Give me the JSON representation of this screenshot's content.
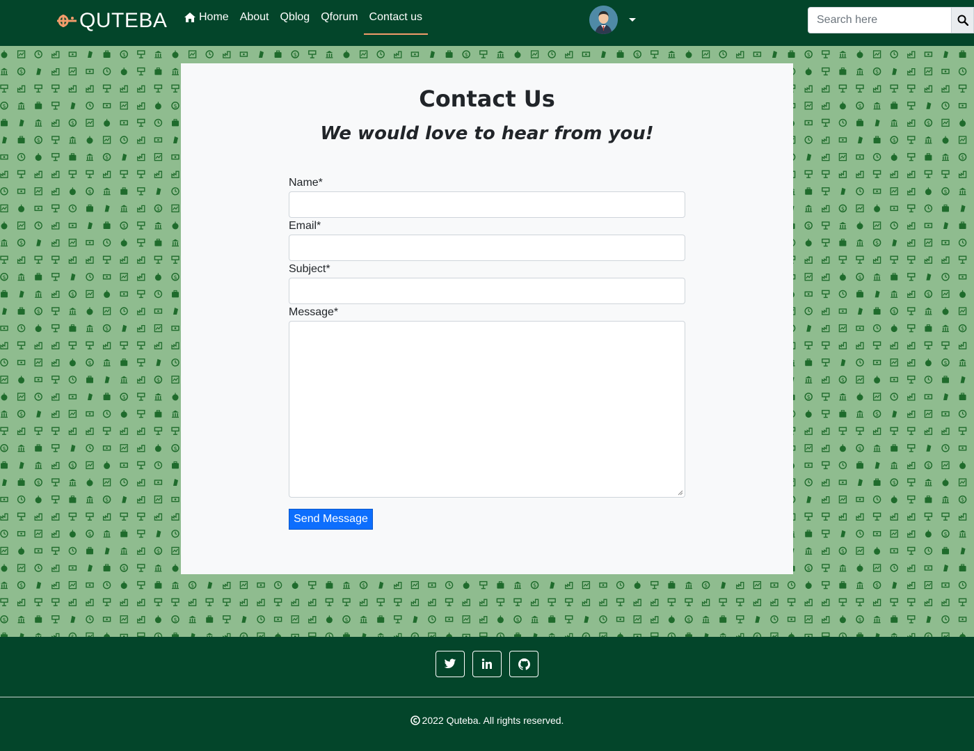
{
  "header": {
    "brand": "QUTEBA",
    "nav": [
      {
        "label": "Home",
        "icon": "home-icon"
      },
      {
        "label": "About"
      },
      {
        "label": "Qblog"
      },
      {
        "label": "Qforum"
      },
      {
        "label": "Contact us",
        "active": true
      }
    ],
    "search_placeholder": "Search here"
  },
  "contact": {
    "title": "Contact Us",
    "subtitle": "We would love to hear from you!",
    "fields": {
      "name_label": "Name*",
      "email_label": "Email*",
      "subject_label": "Subject*",
      "message_label": "Message*"
    },
    "send_label": "Send Message"
  },
  "footer": {
    "social": [
      "twitter-icon",
      "linkedin-icon",
      "github-icon"
    ],
    "copyright": "2022 Quteba. All rights reserved."
  },
  "colors": {
    "navbar": "#03452a",
    "pattern_bg": "#8fbc8f",
    "pattern_icon": "#1f6b2c",
    "accent": "#f29c6b",
    "button": "#0d6efd"
  }
}
